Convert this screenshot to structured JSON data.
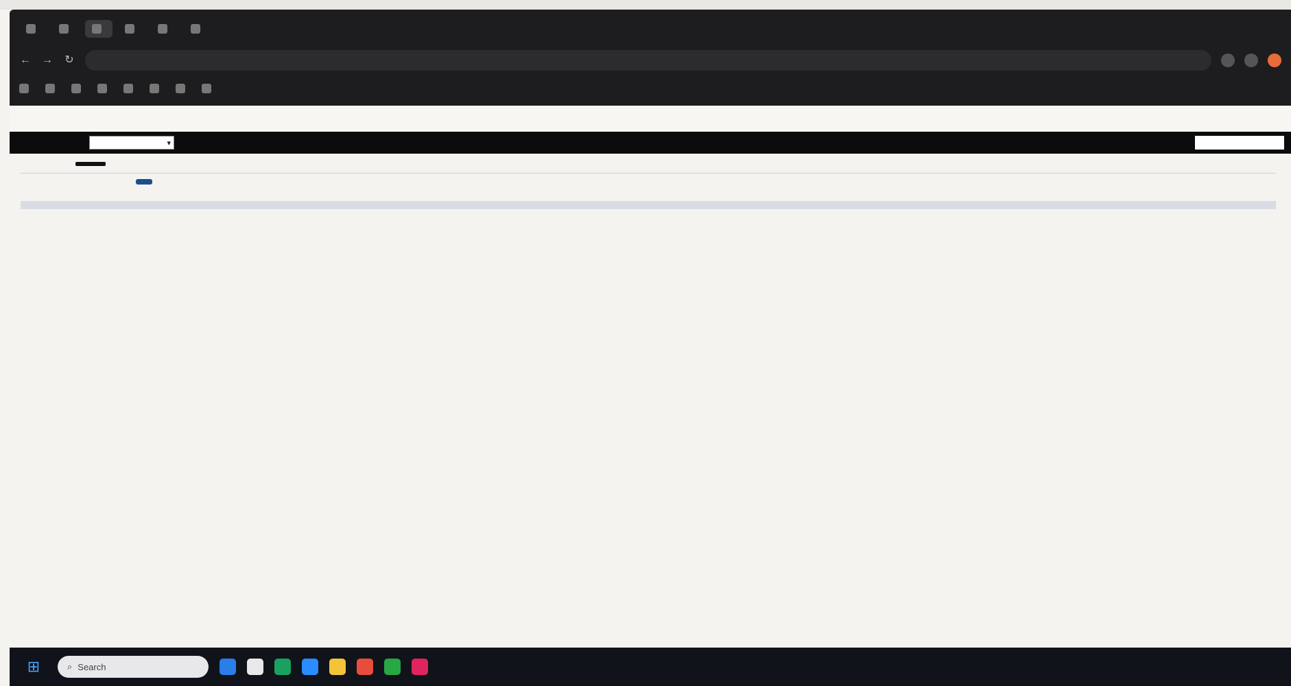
{
  "browser": {
    "tabs": [
      {
        "label": "",
        "active": false
      },
      {
        "label": "",
        "active": false
      },
      {
        "label": "",
        "active": true
      },
      {
        "label": "",
        "active": false
      },
      {
        "label": "",
        "active": false
      },
      {
        "label": "",
        "active": false
      }
    ],
    "url": "",
    "bookmarks": [
      "",
      "",
      "",
      "",
      "",
      "",
      "",
      ""
    ]
  },
  "app": {
    "logo": "",
    "user": "",
    "nav_items": [
      "",
      "",
      "",
      "",
      "",
      ""
    ],
    "nav_select": "",
    "nav_search_placeholder": ""
  },
  "page": {
    "breadcrumb_prefix": "",
    "breadcrumb_current": "",
    "tabs": [
      "",
      "",
      "",
      ""
    ],
    "active_tab_label": "",
    "title": "",
    "primary_button": "",
    "secondary_link": "",
    "section_label": ""
  },
  "table": {
    "headers": [
      "",
      "",
      "",
      "",
      "",
      "",
      "",
      ""
    ],
    "rows": [
      [
        "",
        "",
        "",
        "",
        "",
        "",
        "",
        ""
      ],
      [
        "",
        "",
        "",
        "",
        "",
        "",
        "",
        ""
      ],
      [
        "",
        "",
        "",
        "",
        "",
        "",
        "",
        ""
      ],
      [
        "",
        "",
        "",
        "",
        "",
        "",
        "",
        ""
      ]
    ]
  },
  "footer": {
    "col1_title": "",
    "col1_items": [
      ""
    ],
    "col2_title": "",
    "col2_items": [
      "",
      "",
      "",
      "",
      "",
      ""
    ],
    "col3_title": "",
    "col3_items": [
      ""
    ],
    "bottom_left": "",
    "bottom_right": ""
  },
  "taskbar": {
    "search_placeholder": "Search",
    "icon_colors": [
      "#2b7de9",
      "#e8e8e8",
      "#1aa160",
      "#2b8cff",
      "#f2c43a",
      "#e84c3d",
      "#28a745",
      "#e0245e"
    ]
  }
}
